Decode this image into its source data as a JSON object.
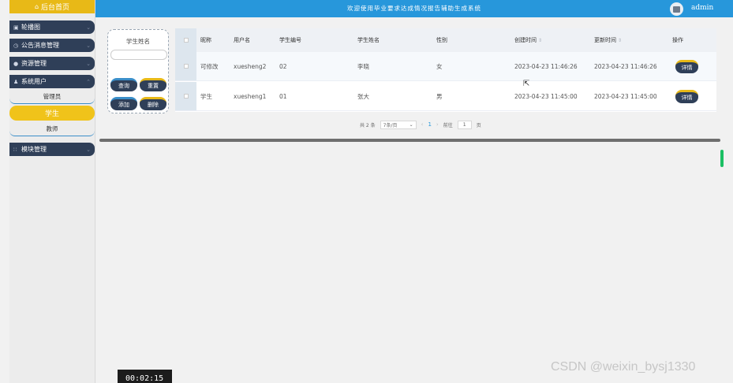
{
  "sidebar": {
    "home_label": "后台首页",
    "groups": [
      {
        "label": "轮播图",
        "icon": "image-icon"
      },
      {
        "label": "公告消息管理",
        "icon": "clock-icon"
      },
      {
        "label": "资源管理",
        "icon": "location-icon"
      },
      {
        "label": "系统用户",
        "icon": "user-icon"
      }
    ],
    "sub_items": [
      {
        "label": "管理员"
      },
      {
        "label": "学生"
      },
      {
        "label": "教师"
      }
    ],
    "module_group": {
      "label": "模块管理",
      "icon": "grid-icon"
    }
  },
  "topbar": {
    "title": "欢迎使用毕业要求达成情况报告辅助生成系统",
    "username": "admin"
  },
  "search": {
    "label": "学生姓名",
    "placeholder": "",
    "buttons": {
      "query": "查询",
      "reset": "重置",
      "add": "添加",
      "delete": "删除"
    }
  },
  "table": {
    "headers": {
      "nickname": "昵称",
      "username": "用户名",
      "student_no": "学生编号",
      "student_name": "学生姓名",
      "gender": "性别",
      "created": "创建时间",
      "updated": "更新时间",
      "actions": "操作"
    },
    "rows": [
      {
        "nickname": "可修改",
        "username": "xuesheng2",
        "student_no": "02",
        "student_name": "李晓",
        "gender": "女",
        "created": "2023-04-23 11:46:26",
        "updated": "2023-04-23 11:46:26",
        "action": "详情"
      },
      {
        "nickname": "学生",
        "username": "xuesheng1",
        "student_no": "01",
        "student_name": "张大",
        "gender": "男",
        "created": "2023-04-23 11:45:00",
        "updated": "2023-04-23 11:45:00",
        "action": "详情"
      }
    ]
  },
  "pager": {
    "total": "共 2 条",
    "page_size": "7条/页",
    "current_page": "1",
    "goto_prefix": "前往",
    "goto_value": "1",
    "goto_suffix": "页"
  },
  "watermark": "CSDN @weixin_bysj1330",
  "time_overlay": "00:02:15",
  "colors": {
    "topbar": "#2797db",
    "accent_yellow": "#e8b917",
    "dark_navy": "#2f3f58"
  }
}
